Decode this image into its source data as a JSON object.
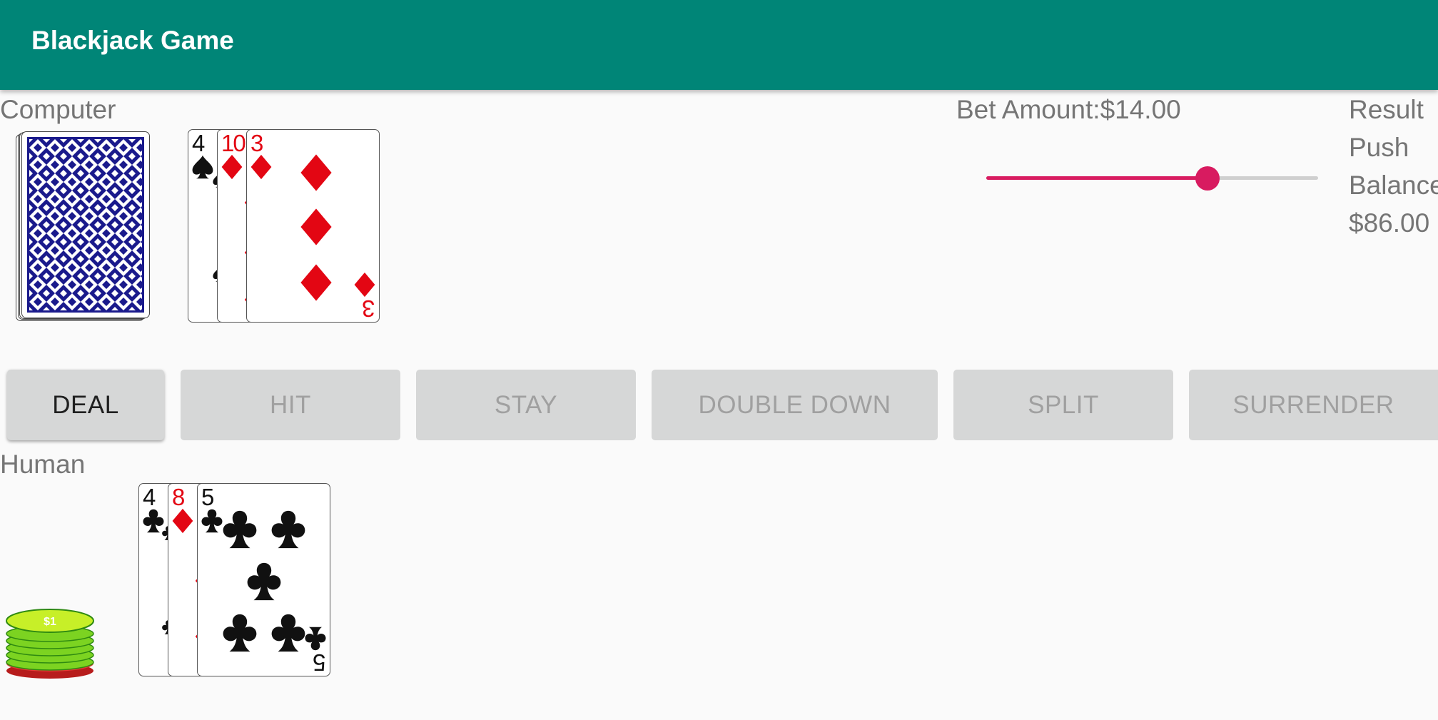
{
  "app": {
    "title": "Blackjack Game"
  },
  "computer": {
    "label": "Computer",
    "cards": [
      {
        "rank": "4",
        "suit": "spades",
        "color": "black"
      },
      {
        "rank": "10",
        "suit": "diamonds",
        "color": "red"
      },
      {
        "rank": "3",
        "suit": "diamonds",
        "color": "red"
      }
    ]
  },
  "bet": {
    "label": "Bet Amount:$14.00",
    "slider_fraction": 0.667
  },
  "result": {
    "label": "Result",
    "value": "Push"
  },
  "balance": {
    "label": "Balance",
    "value": "$86.00"
  },
  "buttons": {
    "deal": "DEAL",
    "hit": "HIT",
    "stay": "STAY",
    "double_down": "DOUBLE DOWN",
    "split": "SPLIT",
    "surrender": "SURRENDER"
  },
  "human": {
    "label": "Human",
    "cards": [
      {
        "rank": "4",
        "suit": "clubs",
        "color": "black"
      },
      {
        "rank": "8",
        "suit": "diamonds",
        "color": "red"
      },
      {
        "rank": "5",
        "suit": "clubs",
        "color": "black"
      }
    ]
  },
  "chips": {
    "label": "$1"
  },
  "colors": {
    "appbar": "#008577",
    "accent": "#d81b60",
    "card_red": "#e30613"
  }
}
